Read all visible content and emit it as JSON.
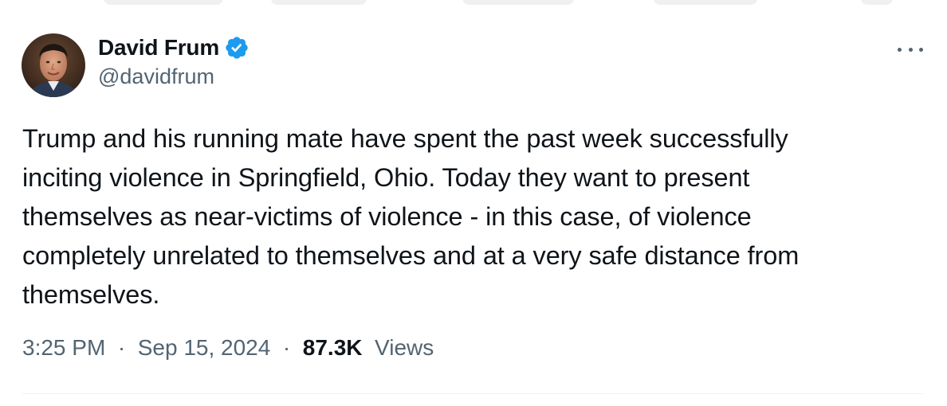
{
  "author": {
    "display_name": "David Frum",
    "handle": "@davidfrum",
    "verified": true,
    "verified_color": "#1d9bf0"
  },
  "icons": {
    "verified": "verified-badge-icon",
    "more": "more-options-icon"
  },
  "tweet": {
    "text_lines": [
      "Trump and his running mate have spent the past week successfully",
      "inciting violence in Springfield, Ohio. Today they want to present",
      "themselves as near-victims of violence - in this case, of violence",
      "completely unrelated to themselves and at a very safe distance from",
      "themselves."
    ]
  },
  "meta": {
    "time": "3:25 PM",
    "separator": "·",
    "date": "Sep 15, 2024",
    "views_count": "87.3K",
    "views_label": "Views"
  },
  "colors": {
    "text_primary": "#0f1419",
    "text_secondary": "#536471",
    "divider": "#eff3f4"
  }
}
